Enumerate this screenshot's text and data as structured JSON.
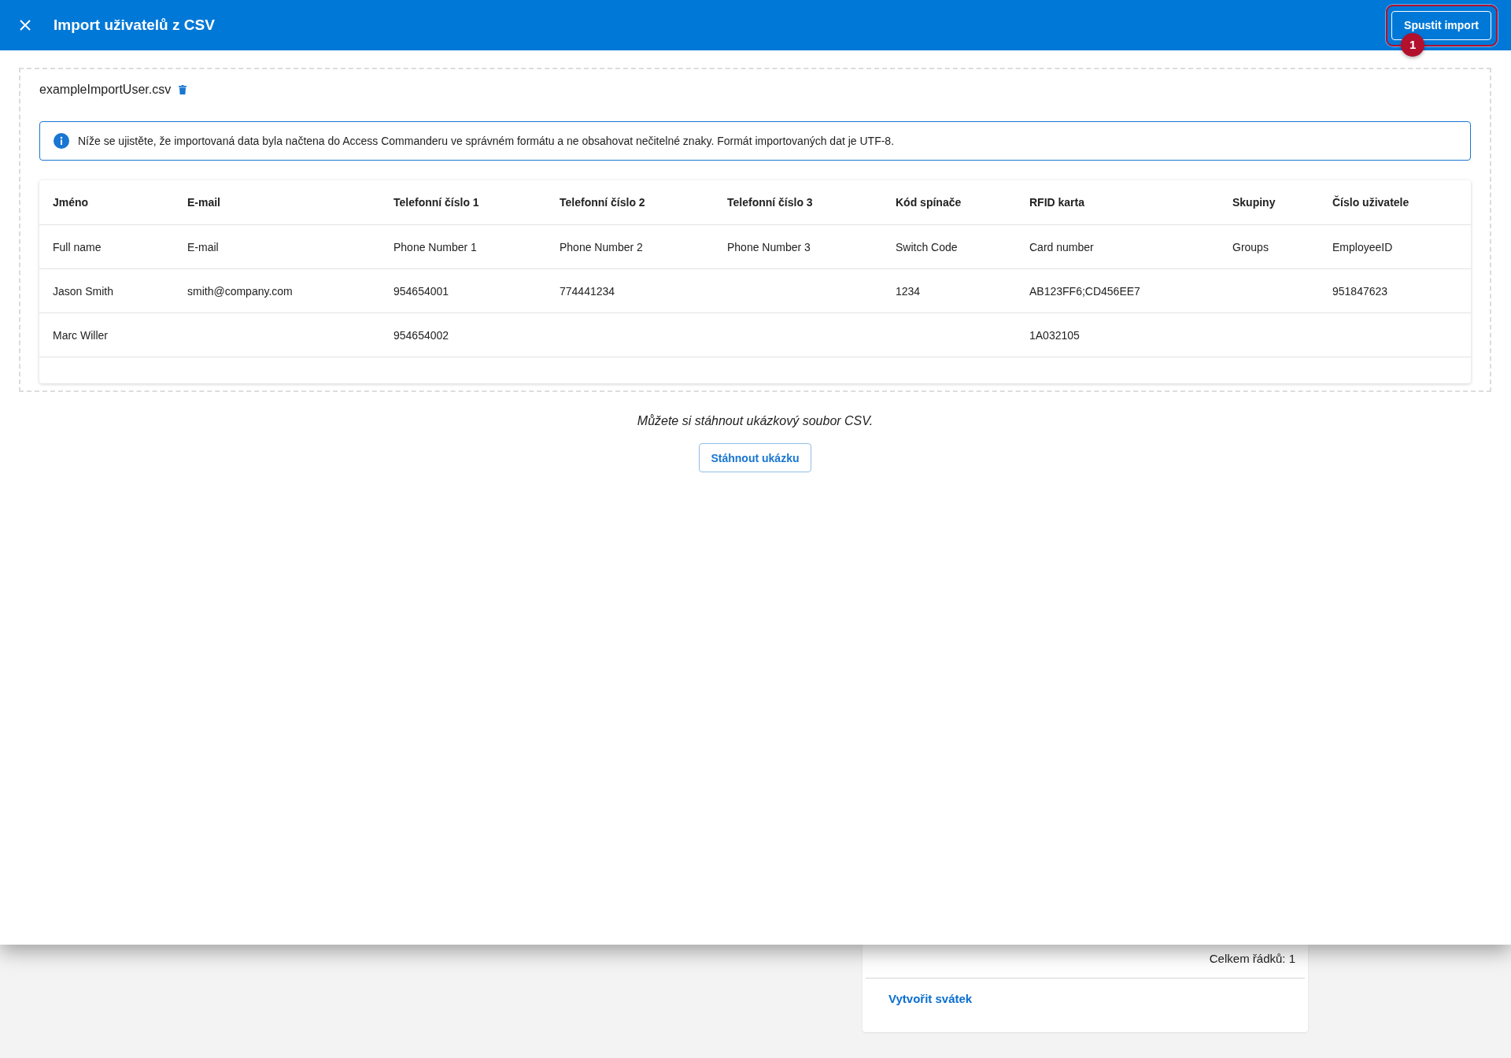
{
  "header": {
    "title": "Import uživatelů z CSV",
    "primary_button": "Spustit import",
    "callout": {
      "label": "1"
    }
  },
  "file": {
    "name": "exampleImportUser.csv"
  },
  "info": {
    "text": "Níže se ujistěte, že importovaná data byla načtena do Access Commanderu ve správném formátu a ne obsahovat nečitelné znaky. Formát importovaných dat je UTF-8."
  },
  "table": {
    "columns": [
      "Jméno",
      "E-mail",
      "Telefonní číslo 1",
      "Telefonní číslo 2",
      "Telefonní číslo 3",
      "Kód spínače",
      "RFID karta",
      "Skupiny",
      "Číslo uživatele"
    ],
    "rows": [
      [
        "Full name",
        "E-mail",
        "Phone Number 1",
        "Phone Number 2",
        "Phone Number 3",
        "Switch Code",
        "Card number",
        "Groups",
        "EmployeeID"
      ],
      [
        "Jason Smith",
        "smith@company.com",
        "954654001",
        "774441234",
        null,
        "1234",
        "AB123FF6;CD456EE7",
        null,
        "951847623"
      ],
      [
        "Marc Willer",
        null,
        "954654002",
        null,
        null,
        null,
        "1A032105",
        null,
        null
      ]
    ]
  },
  "sample": {
    "text": "Můžete si stáhnout ukázkový soubor CSV.",
    "button": "Stáhnout ukázku"
  },
  "background_page": {
    "total_rows": "Celkem řádků: 1",
    "link": "Vytvořit svátek"
  }
}
